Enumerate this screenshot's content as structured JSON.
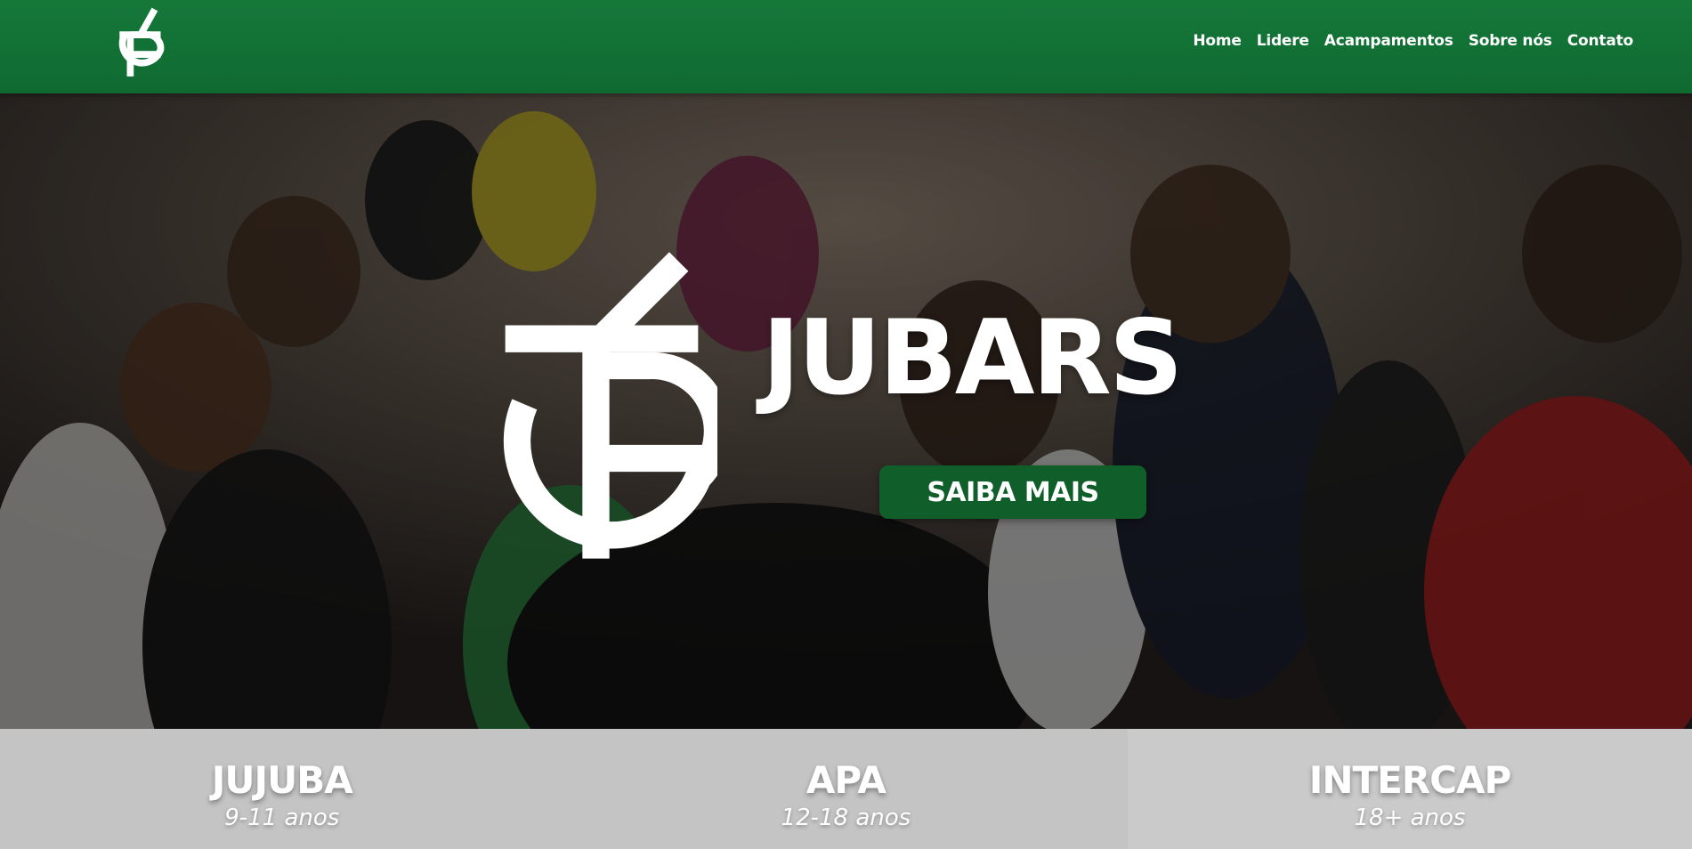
{
  "brand": {
    "name": "JUBARS",
    "primary_color": "#0f6a31",
    "logo_icon": "jb-monogram-icon"
  },
  "nav": {
    "items": [
      {
        "label": "Home"
      },
      {
        "label": "Lidere"
      },
      {
        "label": "Acampamentos"
      },
      {
        "label": "Sobre nós"
      },
      {
        "label": "Contato"
      }
    ]
  },
  "hero": {
    "title": "JUBARS",
    "cta_label": "SAIBA MAIS",
    "background": "photo of youth crowd"
  },
  "camps": [
    {
      "title": "JUJUBA",
      "age": "9-11 anos"
    },
    {
      "title": "APA",
      "age": "12-18 anos"
    },
    {
      "title": "INTERCAP",
      "age": "18+ anos"
    }
  ]
}
